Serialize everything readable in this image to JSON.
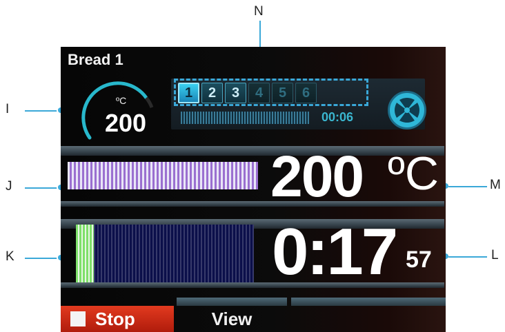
{
  "callouts": [
    "I",
    "J",
    "K",
    "L",
    "M",
    "N"
  ],
  "screen": {
    "program_name": "Bread 1",
    "gauge": {
      "unit": "ºC",
      "value": "200"
    },
    "steps": [
      {
        "label": "1",
        "state": "active"
      },
      {
        "label": "2",
        "state": "done"
      },
      {
        "label": "3",
        "state": "done"
      },
      {
        "label": "4",
        "state": "idle"
      },
      {
        "label": "5",
        "state": "idle"
      },
      {
        "label": "6",
        "state": "idle"
      }
    ],
    "step_time": "00:06",
    "fan_icon": "fan-icon",
    "temperature": {
      "value": "200",
      "unit": "ºC"
    },
    "time": {
      "main": "0:17",
      "seconds": "57"
    },
    "softkeys": {
      "stop_label": "Stop",
      "view_label": "View"
    }
  },
  "colors": {
    "accent": "#3aa8d8",
    "stop": "#d12c15",
    "temp_bar": "#9a6fd0",
    "time_bar_fill": "#7ee06a",
    "time_bar_bg": "#0b0f4a"
  }
}
